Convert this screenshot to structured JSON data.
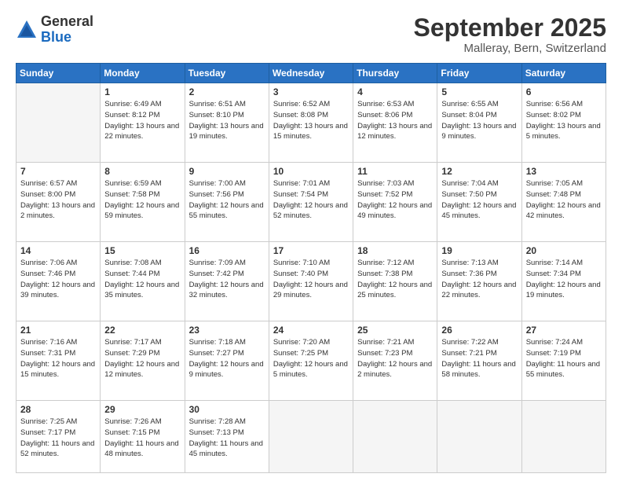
{
  "logo": {
    "general": "General",
    "blue": "Blue"
  },
  "title": "September 2025",
  "location": "Malleray, Bern, Switzerland",
  "weekdays": [
    "Sunday",
    "Monday",
    "Tuesday",
    "Wednesday",
    "Thursday",
    "Friday",
    "Saturday"
  ],
  "weeks": [
    [
      {
        "day": "",
        "empty": true
      },
      {
        "day": "1",
        "sunrise": "Sunrise: 6:49 AM",
        "sunset": "Sunset: 8:12 PM",
        "daylight": "Daylight: 13 hours and 22 minutes."
      },
      {
        "day": "2",
        "sunrise": "Sunrise: 6:51 AM",
        "sunset": "Sunset: 8:10 PM",
        "daylight": "Daylight: 13 hours and 19 minutes."
      },
      {
        "day": "3",
        "sunrise": "Sunrise: 6:52 AM",
        "sunset": "Sunset: 8:08 PM",
        "daylight": "Daylight: 13 hours and 15 minutes."
      },
      {
        "day": "4",
        "sunrise": "Sunrise: 6:53 AM",
        "sunset": "Sunset: 8:06 PM",
        "daylight": "Daylight: 13 hours and 12 minutes."
      },
      {
        "day": "5",
        "sunrise": "Sunrise: 6:55 AM",
        "sunset": "Sunset: 8:04 PM",
        "daylight": "Daylight: 13 hours and 9 minutes."
      },
      {
        "day": "6",
        "sunrise": "Sunrise: 6:56 AM",
        "sunset": "Sunset: 8:02 PM",
        "daylight": "Daylight: 13 hours and 5 minutes."
      }
    ],
    [
      {
        "day": "7",
        "sunrise": "Sunrise: 6:57 AM",
        "sunset": "Sunset: 8:00 PM",
        "daylight": "Daylight: 13 hours and 2 minutes."
      },
      {
        "day": "8",
        "sunrise": "Sunrise: 6:59 AM",
        "sunset": "Sunset: 7:58 PM",
        "daylight": "Daylight: 12 hours and 59 minutes."
      },
      {
        "day": "9",
        "sunrise": "Sunrise: 7:00 AM",
        "sunset": "Sunset: 7:56 PM",
        "daylight": "Daylight: 12 hours and 55 minutes."
      },
      {
        "day": "10",
        "sunrise": "Sunrise: 7:01 AM",
        "sunset": "Sunset: 7:54 PM",
        "daylight": "Daylight: 12 hours and 52 minutes."
      },
      {
        "day": "11",
        "sunrise": "Sunrise: 7:03 AM",
        "sunset": "Sunset: 7:52 PM",
        "daylight": "Daylight: 12 hours and 49 minutes."
      },
      {
        "day": "12",
        "sunrise": "Sunrise: 7:04 AM",
        "sunset": "Sunset: 7:50 PM",
        "daylight": "Daylight: 12 hours and 45 minutes."
      },
      {
        "day": "13",
        "sunrise": "Sunrise: 7:05 AM",
        "sunset": "Sunset: 7:48 PM",
        "daylight": "Daylight: 12 hours and 42 minutes."
      }
    ],
    [
      {
        "day": "14",
        "sunrise": "Sunrise: 7:06 AM",
        "sunset": "Sunset: 7:46 PM",
        "daylight": "Daylight: 12 hours and 39 minutes."
      },
      {
        "day": "15",
        "sunrise": "Sunrise: 7:08 AM",
        "sunset": "Sunset: 7:44 PM",
        "daylight": "Daylight: 12 hours and 35 minutes."
      },
      {
        "day": "16",
        "sunrise": "Sunrise: 7:09 AM",
        "sunset": "Sunset: 7:42 PM",
        "daylight": "Daylight: 12 hours and 32 minutes."
      },
      {
        "day": "17",
        "sunrise": "Sunrise: 7:10 AM",
        "sunset": "Sunset: 7:40 PM",
        "daylight": "Daylight: 12 hours and 29 minutes."
      },
      {
        "day": "18",
        "sunrise": "Sunrise: 7:12 AM",
        "sunset": "Sunset: 7:38 PM",
        "daylight": "Daylight: 12 hours and 25 minutes."
      },
      {
        "day": "19",
        "sunrise": "Sunrise: 7:13 AM",
        "sunset": "Sunset: 7:36 PM",
        "daylight": "Daylight: 12 hours and 22 minutes."
      },
      {
        "day": "20",
        "sunrise": "Sunrise: 7:14 AM",
        "sunset": "Sunset: 7:34 PM",
        "daylight": "Daylight: 12 hours and 19 minutes."
      }
    ],
    [
      {
        "day": "21",
        "sunrise": "Sunrise: 7:16 AM",
        "sunset": "Sunset: 7:31 PM",
        "daylight": "Daylight: 12 hours and 15 minutes."
      },
      {
        "day": "22",
        "sunrise": "Sunrise: 7:17 AM",
        "sunset": "Sunset: 7:29 PM",
        "daylight": "Daylight: 12 hours and 12 minutes."
      },
      {
        "day": "23",
        "sunrise": "Sunrise: 7:18 AM",
        "sunset": "Sunset: 7:27 PM",
        "daylight": "Daylight: 12 hours and 9 minutes."
      },
      {
        "day": "24",
        "sunrise": "Sunrise: 7:20 AM",
        "sunset": "Sunset: 7:25 PM",
        "daylight": "Daylight: 12 hours and 5 minutes."
      },
      {
        "day": "25",
        "sunrise": "Sunrise: 7:21 AM",
        "sunset": "Sunset: 7:23 PM",
        "daylight": "Daylight: 12 hours and 2 minutes."
      },
      {
        "day": "26",
        "sunrise": "Sunrise: 7:22 AM",
        "sunset": "Sunset: 7:21 PM",
        "daylight": "Daylight: 11 hours and 58 minutes."
      },
      {
        "day": "27",
        "sunrise": "Sunrise: 7:24 AM",
        "sunset": "Sunset: 7:19 PM",
        "daylight": "Daylight: 11 hours and 55 minutes."
      }
    ],
    [
      {
        "day": "28",
        "sunrise": "Sunrise: 7:25 AM",
        "sunset": "Sunset: 7:17 PM",
        "daylight": "Daylight: 11 hours and 52 minutes."
      },
      {
        "day": "29",
        "sunrise": "Sunrise: 7:26 AM",
        "sunset": "Sunset: 7:15 PM",
        "daylight": "Daylight: 11 hours and 48 minutes."
      },
      {
        "day": "30",
        "sunrise": "Sunrise: 7:28 AM",
        "sunset": "Sunset: 7:13 PM",
        "daylight": "Daylight: 11 hours and 45 minutes."
      },
      {
        "day": "",
        "empty": true
      },
      {
        "day": "",
        "empty": true
      },
      {
        "day": "",
        "empty": true
      },
      {
        "day": "",
        "empty": true
      }
    ]
  ]
}
